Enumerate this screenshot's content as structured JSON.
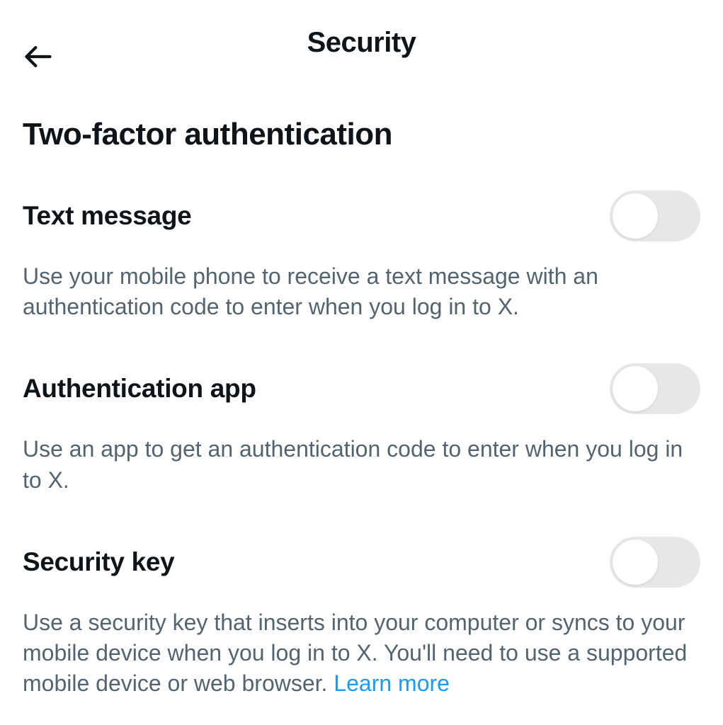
{
  "header": {
    "title": "Security"
  },
  "section": {
    "heading": "Two-factor authentication"
  },
  "options": {
    "text_message": {
      "title": "Text message",
      "description": "Use your mobile phone to receive a text message with an authentication code to enter when you log in to X.",
      "enabled": false
    },
    "auth_app": {
      "title": "Authentication app",
      "description": "Use an app to get an authentication code to enter when you log in to X.",
      "enabled": false
    },
    "security_key": {
      "title": "Security key",
      "description": "Use a security key that inserts into your computer or syncs to your mobile device when you log in to X. You'll need to use a supported mobile device or web browser. ",
      "learn_more": "Learn more",
      "enabled": false
    }
  }
}
